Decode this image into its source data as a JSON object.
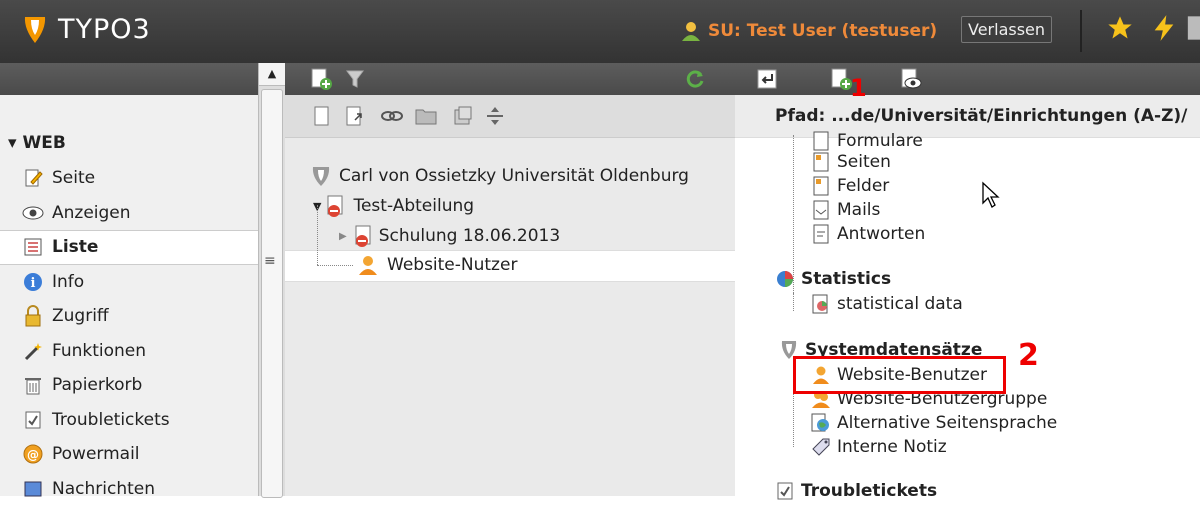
{
  "header": {
    "logo_text": "TYPO3",
    "su_label": "SU: Test User (testuser)",
    "logout_label": "Verlassen"
  },
  "sidebar": {
    "group_label": "WEB",
    "modules": [
      {
        "label": "Seite",
        "icon": "page-edit-icon"
      },
      {
        "label": "Anzeigen",
        "icon": "eye-icon"
      },
      {
        "label": "Liste",
        "icon": "list-icon",
        "active": true
      },
      {
        "label": "Info",
        "icon": "info-icon"
      },
      {
        "label": "Zugriff",
        "icon": "lock-icon"
      },
      {
        "label": "Funktionen",
        "icon": "wand-icon"
      },
      {
        "label": "Papierkorb",
        "icon": "trash-icon"
      },
      {
        "label": "Troubletickets",
        "icon": "ticket-icon"
      },
      {
        "label": "Powermail",
        "icon": "powermail-icon"
      },
      {
        "label": "Nachrichten",
        "icon": "news-icon"
      }
    ]
  },
  "tree": {
    "root": "Carl von Ossietzky Universität Oldenburg",
    "items": [
      "Test-Abteilung",
      "Schulung 18.06.2013",
      "Website-Nutzer"
    ]
  },
  "content": {
    "path_label": "Pfad:",
    "path_value": "...de/Universität/Einrichtungen (A-Z)/",
    "form_items": [
      "Formulare",
      "Seiten",
      "Felder",
      "Mails",
      "Antworten"
    ],
    "statistics_title": "Statistics",
    "statistics_items": [
      "statistical data"
    ],
    "system_title": "Systemdatensätze",
    "system_items": [
      "Website-Benutzer",
      "Website-Benutzergruppe",
      "Alternative Seitensprache",
      "Interne Notiz"
    ],
    "troubletickets_title": "Troubletickets"
  },
  "annotations": {
    "one": "1",
    "two": "2"
  },
  "colors": {
    "su": "#ef8a3a",
    "annotation": "#e00000",
    "topbar": "#3a3a3a"
  }
}
